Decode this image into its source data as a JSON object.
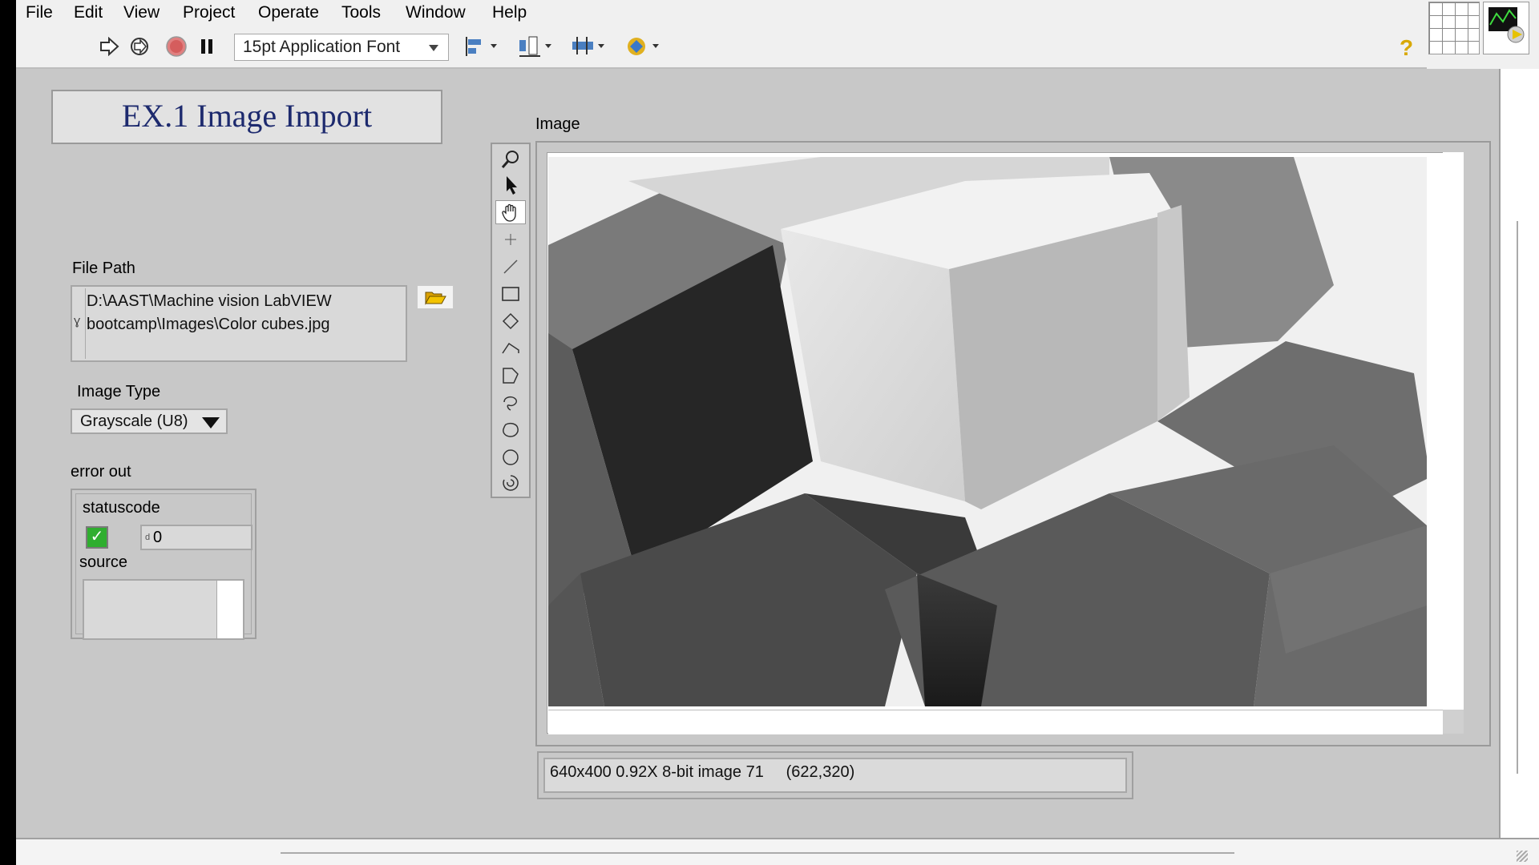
{
  "menu": {
    "items": [
      "File",
      "Edit",
      "View",
      "Project",
      "Operate",
      "Tools",
      "Window",
      "Help"
    ]
  },
  "toolbar": {
    "icons": [
      "run-arrow-icon",
      "run-continuously-icon",
      "abort-icon",
      "pause-icon",
      "align-objects-icon",
      "distribute-objects-icon",
      "resize-objects-icon",
      "reorder-icon",
      "help-icon"
    ],
    "font": "15pt Application Font"
  },
  "panel": {
    "title": "EX.1 Image Import",
    "file_path": {
      "label": "File Path",
      "line1": "D:\\AAST\\Machine vision LabVIEW",
      "line2": "bootcamp\\Images\\Color cubes.jpg"
    },
    "image_type": {
      "label": "Image Type",
      "value": "Grayscale (U8)"
    },
    "error_out": {
      "label": "error out",
      "status_code_label": "statuscode",
      "status_ok": true,
      "code": "0",
      "source_label": "source",
      "source_value": ""
    },
    "image_display": {
      "label": "Image",
      "info": "640x400 0.92X 8-bit image 71     (622,320)"
    }
  },
  "palette_tools": [
    "zoom-icon",
    "pointer-icon",
    "pan-hand-icon",
    "point-tool-icon",
    "line-tool-icon",
    "rectangle-tool-icon",
    "rotated-rectangle-tool-icon",
    "polyline-tool-icon",
    "polygon-tool-icon",
    "freehand-line-icon",
    "freehand-region-icon",
    "oval-tool-icon",
    "annulus-tool-icon"
  ],
  "colors": {
    "panel_bg": "#c8c8c8",
    "title_text": "#1d2a6e",
    "status_ok": "#2fae2f"
  }
}
